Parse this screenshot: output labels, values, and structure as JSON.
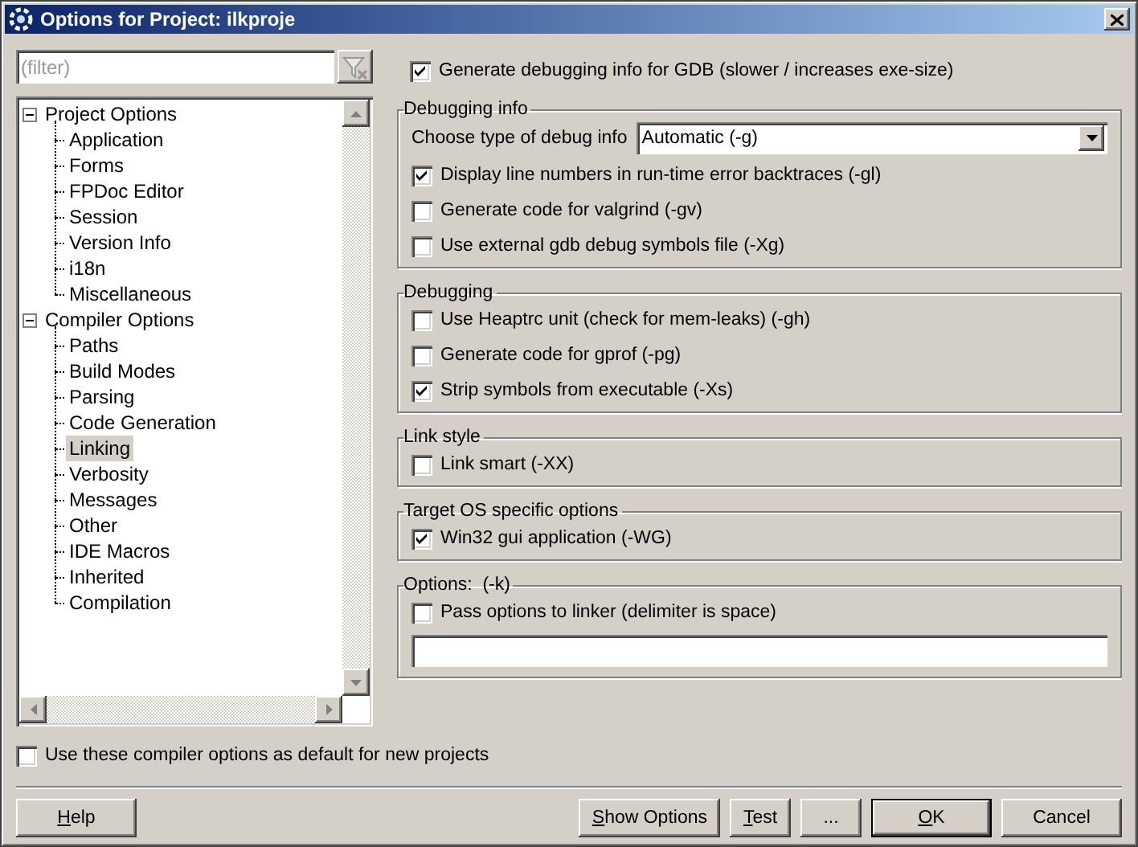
{
  "window": {
    "title": "Options for Project: ilkproje"
  },
  "filter": {
    "placeholder": "(filter)"
  },
  "tree": [
    {
      "label": "Project Options",
      "expanded": true,
      "selected": false,
      "children": [
        {
          "label": "Application",
          "selected": false
        },
        {
          "label": "Forms",
          "selected": false
        },
        {
          "label": "FPDoc Editor",
          "selected": false
        },
        {
          "label": "Session",
          "selected": false
        },
        {
          "label": "Version Info",
          "selected": false
        },
        {
          "label": "i18n",
          "selected": false
        },
        {
          "label": "Miscellaneous",
          "selected": false
        }
      ]
    },
    {
      "label": "Compiler Options",
      "expanded": true,
      "selected": false,
      "children": [
        {
          "label": "Paths",
          "selected": false
        },
        {
          "label": "Build Modes",
          "selected": false
        },
        {
          "label": "Parsing",
          "selected": false
        },
        {
          "label": "Code Generation",
          "selected": false
        },
        {
          "label": "Linking",
          "selected": true
        },
        {
          "label": "Verbosity",
          "selected": false
        },
        {
          "label": "Messages",
          "selected": false
        },
        {
          "label": "Other",
          "selected": false
        },
        {
          "label": "IDE Macros",
          "selected": false
        },
        {
          "label": "Inherited",
          "selected": false
        },
        {
          "label": "Compilation",
          "selected": false
        }
      ]
    }
  ],
  "top_option": {
    "label": "Generate debugging info for GDB (slower / increases exe-size)",
    "checked": true
  },
  "groups": [
    {
      "title": "Debugging info",
      "items": [
        {
          "kind": "select",
          "label": "Choose type of debug info",
          "value": "Automatic (-g)"
        },
        {
          "kind": "checkbox",
          "label": "Display line numbers in run-time error backtraces (-gl)",
          "checked": true
        },
        {
          "kind": "checkbox",
          "label": "Generate code for valgrind (-gv)",
          "checked": false
        },
        {
          "kind": "checkbox",
          "label": "Use external gdb debug symbols file (-Xg)",
          "checked": false
        }
      ]
    },
    {
      "title": "Debugging",
      "items": [
        {
          "kind": "checkbox",
          "label": "Use Heaptrc unit (check for mem-leaks) (-gh)",
          "checked": false
        },
        {
          "kind": "checkbox",
          "label": "Generate code for gprof (-pg)",
          "checked": false
        },
        {
          "kind": "checkbox",
          "label": "Strip symbols from executable (-Xs)",
          "checked": true
        }
      ]
    },
    {
      "title": "Link style",
      "items": [
        {
          "kind": "checkbox",
          "label": "Link smart (-XX)",
          "checked": false
        }
      ]
    },
    {
      "title": "Target OS specific options",
      "items": [
        {
          "kind": "checkbox",
          "label": "Win32 gui application (-WG)",
          "checked": true
        }
      ]
    },
    {
      "title": "Options:  (-k)",
      "items": [
        {
          "kind": "checkbox",
          "label": "Pass options to linker (delimiter is space)",
          "checked": false
        },
        {
          "kind": "text_field"
        }
      ]
    }
  ],
  "default_option": {
    "label": "Use these compiler options as default for new projects",
    "checked": false
  },
  "buttons": [
    {
      "label": "Help",
      "first_letter_underlined": true,
      "default": false
    },
    {
      "label": "Show Options",
      "first_letter_underlined": true,
      "default": false
    },
    {
      "label": "Test",
      "first_letter_underlined": true,
      "default": false
    },
    {
      "label": "...",
      "default": false
    },
    {
      "label": "OK",
      "first_letter_underlined": true,
      "default": true
    },
    {
      "label": "Cancel",
      "default": false
    }
  ]
}
